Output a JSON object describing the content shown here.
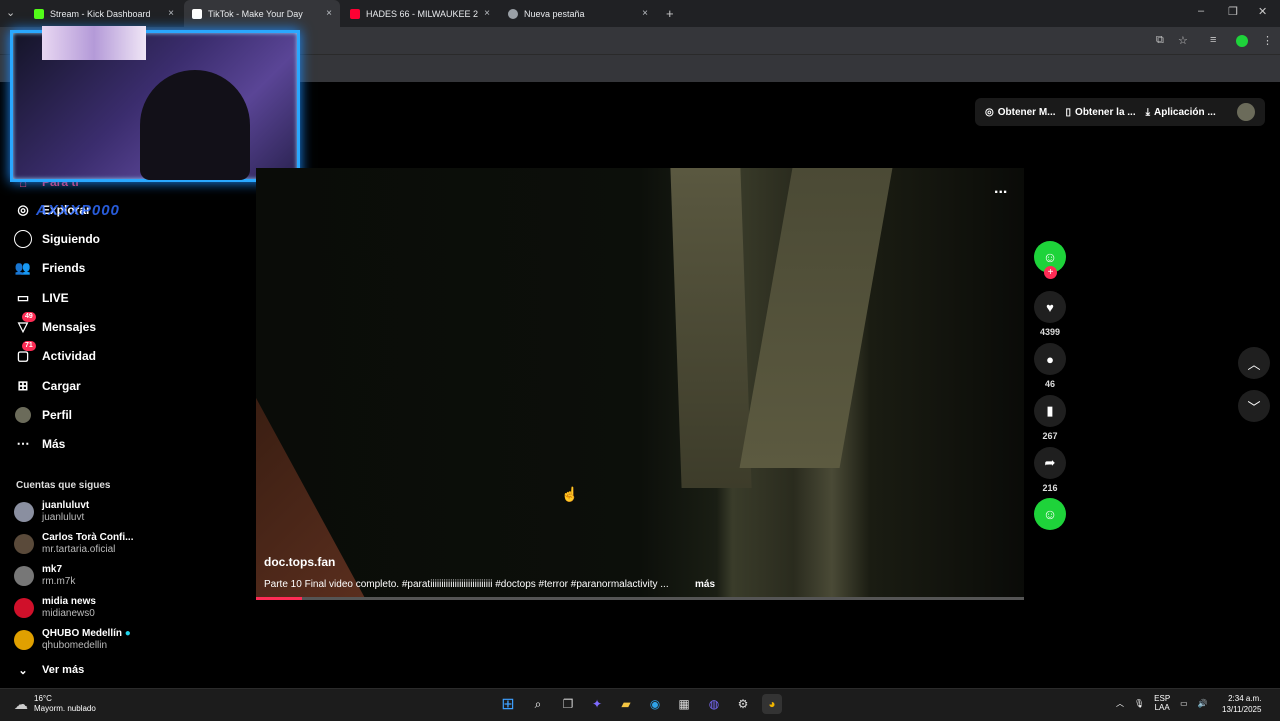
{
  "browser": {
    "tabs": [
      {
        "label": "Stream - Kick Dashboard",
        "color": "#53fc18",
        "active": false
      },
      {
        "label": "TikTok - Make Your Day",
        "color": "#ffffff",
        "active": true
      },
      {
        "label": "HADES 66 - MILWAUKEE 2",
        "color": "#ff0033",
        "active": false
      },
      {
        "label": "Nueva pestaña",
        "color": "#9aa0a6",
        "active": false
      }
    ],
    "new_tab_symbol": "+",
    "close_symbol": "×"
  },
  "overlay": {
    "watermark": "AXXXP000"
  },
  "sidebar": {
    "items": [
      {
        "label": "Para ti",
        "icon": "home-icon"
      },
      {
        "label": "Explorar",
        "icon": "compass-icon"
      },
      {
        "label": "Siguiendo",
        "icon": "following-icon"
      },
      {
        "label": "Friends",
        "icon": "friends-icon"
      },
      {
        "label": "LIVE",
        "icon": "live-icon"
      },
      {
        "label": "Mensajes",
        "icon": "messages-icon",
        "badge": "49"
      },
      {
        "label": "Actividad",
        "icon": "activity-icon",
        "badge": "71"
      },
      {
        "label": "Cargar",
        "icon": "upload-icon"
      },
      {
        "label": "Perfil",
        "icon": "profile-icon"
      },
      {
        "label": "Más",
        "icon": "more-icon"
      }
    ],
    "following_title": "Cuentas que sigues",
    "accounts": [
      {
        "name": "juanluluvt",
        "handle": "juanluluvt"
      },
      {
        "name": "Carlos Torà Confi...",
        "handle": "mr.tartaria.oficial"
      },
      {
        "name": "mk7",
        "handle": "rm.m7k"
      },
      {
        "name": "midia news",
        "handle": "midianews0"
      },
      {
        "name": "QHUBO Medellín",
        "handle": "qhubomedellin"
      }
    ],
    "see_more": "Ver más"
  },
  "header": {
    "buttons": [
      "Obtener M...",
      "Obtener la ...",
      "Aplicación ..."
    ]
  },
  "video": {
    "author": "doc.tops.fan",
    "caption": "Parte 10 Final video completo. #paratiiiiiiiiiiiiiiiiiiiiiiiiiiii #doctops #terror #paranormalactivity ...",
    "more": "más",
    "menu": "...",
    "progress": 0.06
  },
  "actions": {
    "likes": "4399",
    "comments": "46",
    "saves": "267",
    "shares": "216"
  },
  "taskbar": {
    "temperature": "16°C",
    "weather": "Mayorm. nublado",
    "lang_top": "ESP",
    "lang_bottom": "LAA",
    "time": "2:34 a.m.",
    "date": "13/11/2025"
  }
}
